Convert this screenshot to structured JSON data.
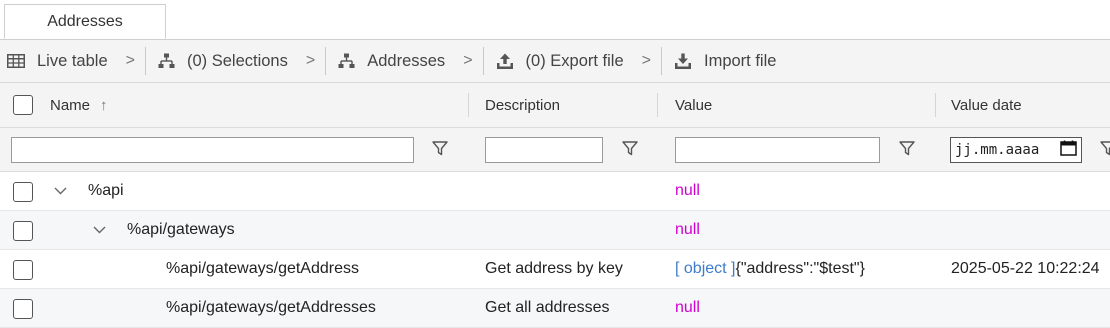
{
  "tabs": [
    {
      "label": "Addresses"
    }
  ],
  "toolbar": {
    "items": [
      {
        "label": "Live table",
        "icon": "table-icon"
      },
      {
        "label": "(0) Selections",
        "icon": "hierarchy-icon"
      },
      {
        "label": "Addresses",
        "icon": "hierarchy-icon"
      },
      {
        "label": "(0) Export file",
        "icon": "upload-icon"
      },
      {
        "label": "Import file",
        "icon": "download-icon"
      }
    ],
    "separator": ">"
  },
  "table": {
    "columns": {
      "name": "Name",
      "description": "Description",
      "value": "Value",
      "value_date": "Value date"
    },
    "sort_indicator": "↑",
    "filters": {
      "name": "",
      "description": "",
      "value": "",
      "value_date_placeholder": "jj.mm.aaaa"
    },
    "rows": [
      {
        "name": "%api",
        "description": "",
        "value_null": "null",
        "date": ""
      },
      {
        "name": "%api/gateways",
        "description": "",
        "value_null": "null",
        "date": ""
      },
      {
        "name": "%api/gateways/getAddress",
        "description": "Get address by key",
        "value_tag": "[ object ]",
        "value_text": "{\"address\":\"$test\"}",
        "date": "2025-05-22 10:22:24"
      },
      {
        "name": "%api/gateways/getAddresses",
        "description": "Get all addresses",
        "value_null": "null",
        "date": ""
      }
    ]
  },
  "colors": {
    "null": "#d100d1",
    "object_tag": "#3d7cc9",
    "header_bg": "#f4f4f4"
  }
}
